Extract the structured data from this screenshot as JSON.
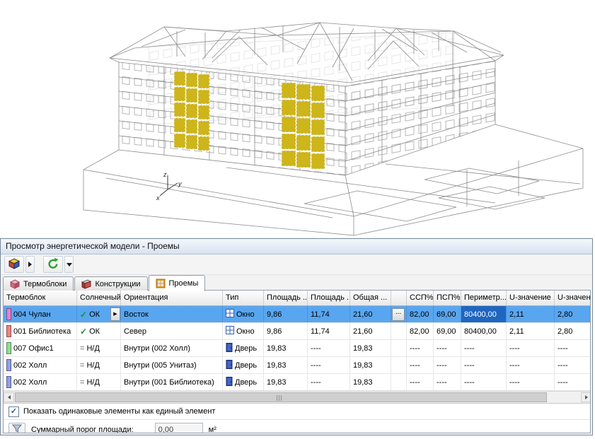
{
  "viewport": {
    "axis": {
      "x": "x",
      "y": "y",
      "z": "z"
    }
  },
  "window": {
    "title": "Просмотр энергетической модели - Проемы",
    "tabs": [
      {
        "label": "Термоблоки"
      },
      {
        "label": "Конструкции"
      },
      {
        "label": "Проемы"
      }
    ],
    "icons": {
      "ok_check": "✓",
      "nd_glyph": "=",
      "cell_dropdown": "▶",
      "checkbox_check": "✓"
    },
    "table": {
      "columns": [
        "Термоблок",
        "Солнечный ...",
        "Ориентация",
        "Тип",
        "Площадь ...",
        "Площадь ...",
        "Общая ...",
        "",
        "ССП%",
        "ПСП%",
        "Периметр...",
        "U-значение ...",
        "U-значени..."
      ],
      "ellipsis_button": "...",
      "rows": [
        {
          "color": "#e77fd2",
          "thermoblock": "004 Чулан",
          "solar": "ОК",
          "orientation": "Восток",
          "type": "Окно",
          "area_window": "9,86",
          "area_lighting": "11,74",
          "area_total": "21,60",
          "ssp": "82,00",
          "psp": "69,00",
          "perimeter": "80400,00",
          "u_value": "2,11",
          "u_value2": "2,80",
          "selected": true
        },
        {
          "color": "#f2827f",
          "thermoblock": "001 Библиотека",
          "solar": "ОК",
          "orientation": "Север",
          "type": "Окно",
          "area_window": "9,86",
          "area_lighting": "11,74",
          "area_total": "21,60",
          "ssp": "82,00",
          "psp": "69,00",
          "perimeter": "80400,00",
          "u_value": "2,11",
          "u_value2": "2,80",
          "selected": false
        },
        {
          "color": "#8fe08f",
          "thermoblock": "007 Офис1",
          "solar": "Н/Д",
          "orientation": "Внутри (002 Холл)",
          "type": "Дверь",
          "area_window": "19,83",
          "area_lighting": "----",
          "area_total": "19,83",
          "ssp": "----",
          "psp": "----",
          "perimeter": "----",
          "u_value": "----",
          "u_value2": "----",
          "selected": false
        },
        {
          "color": "#8f9fe8",
          "thermoblock": "002 Холл",
          "solar": "Н/Д",
          "orientation": "Внутри (005 Унитаз)",
          "type": "Дверь",
          "area_window": "19,83",
          "area_lighting": "----",
          "area_total": "19,83",
          "ssp": "----",
          "psp": "----",
          "perimeter": "----",
          "u_value": "----",
          "u_value2": "----",
          "selected": false
        },
        {
          "color": "#8f9fe8",
          "thermoblock": "002 Холл",
          "solar": "Н/Д",
          "orientation": "Внутри (001 Библиотека)",
          "type": "Дверь",
          "area_window": "19,83",
          "area_lighting": "----",
          "area_total": "19,83",
          "ssp": "----",
          "psp": "----",
          "perimeter": "----",
          "u_value": "----",
          "u_value2": "----",
          "selected": false
        }
      ]
    },
    "footer": {
      "merge_checkbox_label": "Показать одинаковые элементы как единый элемент",
      "threshold_label": "Суммарный порог площади:",
      "threshold_value": "0,00",
      "threshold_unit": "м²"
    }
  }
}
